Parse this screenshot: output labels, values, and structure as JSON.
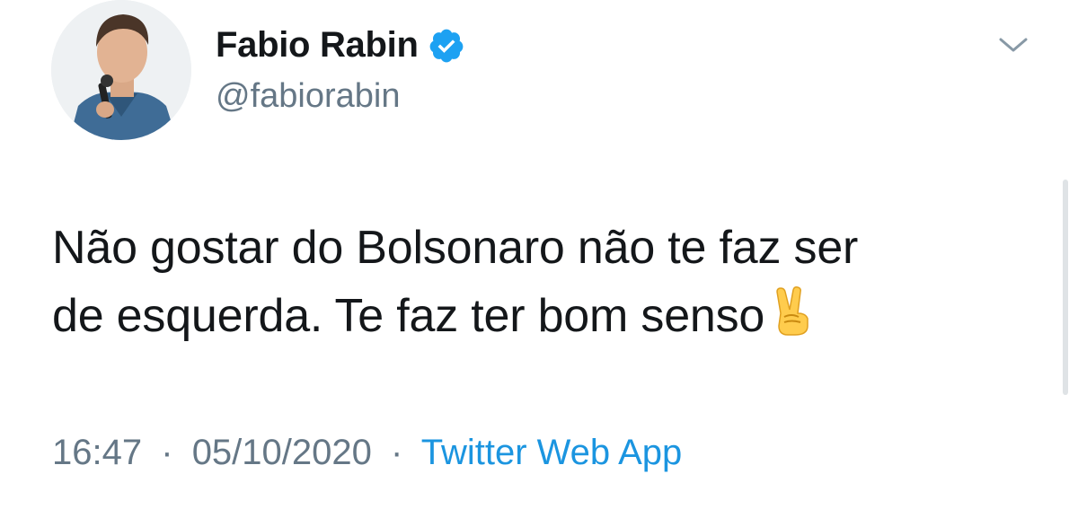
{
  "tweet": {
    "author": {
      "display_name": "Fabio Rabin",
      "handle": "@fabiorabin",
      "verified": true,
      "avatar_icon": "profile-photo"
    },
    "text_line1": "Não gostar do Bolsonaro não te faz ser",
    "text_line2": "de esquerda. Te faz ter bom senso",
    "emoji": "victory-hand-emoji",
    "time": "16:47",
    "date": "05/10/2020",
    "separator": "·",
    "source": "Twitter Web App"
  },
  "colors": {
    "text": "#14171a",
    "secondary": "#657786",
    "link": "#1b95e0",
    "verified": "#1da1f2"
  }
}
